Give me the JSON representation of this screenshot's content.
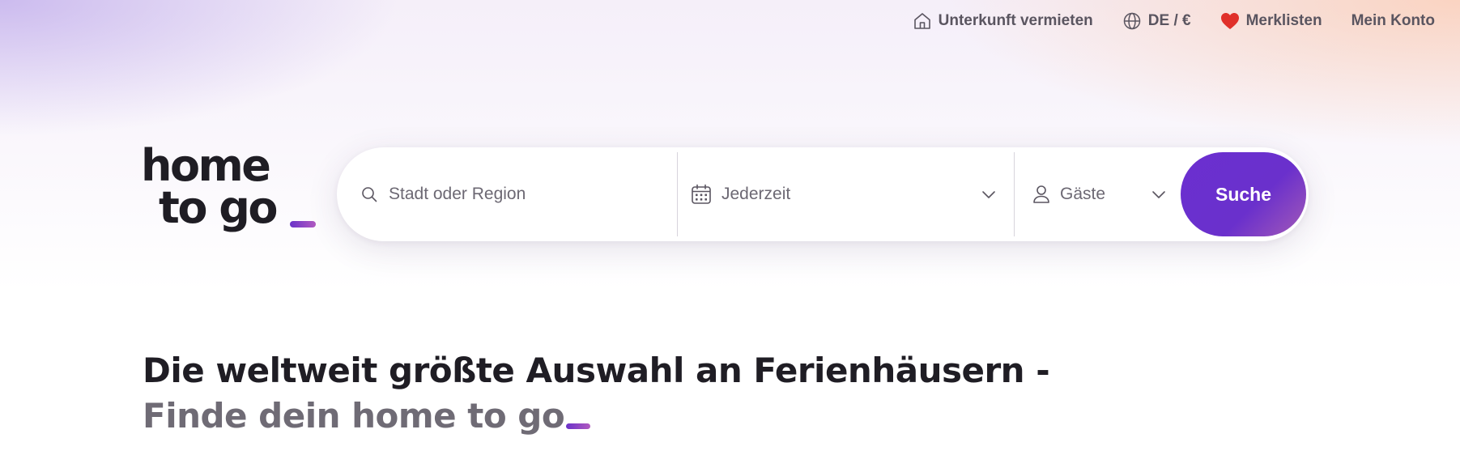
{
  "nav": {
    "list_property": "Unterkunft vermieten",
    "locale": "DE / €",
    "wishlists": "Merklisten",
    "account": "Mein Konto"
  },
  "logo": {
    "line1": "home",
    "line2": "to go",
    "alt": "home to go"
  },
  "search": {
    "destination_placeholder": "Stadt oder Region",
    "destination_value": "",
    "dates_label": "Jederzeit",
    "guests_label": "Gäste",
    "submit_label": "Suche"
  },
  "headline": {
    "line1": "Die weltweit größte Auswahl an Ferienhäusern -",
    "line2": "Finde dein home to go"
  },
  "colors": {
    "brand_purple": "#6b2fd0",
    "heart_red": "#e0302a",
    "text_dark": "#1f1d24",
    "text_muted": "#6f6b75"
  },
  "icons": {
    "list_property": "house-icon",
    "locale": "globe-icon",
    "wishlists": "heart-icon",
    "destination": "search-icon",
    "dates": "calendar-icon",
    "guests": "person-icon",
    "dropdown": "chevron-down-icon"
  }
}
